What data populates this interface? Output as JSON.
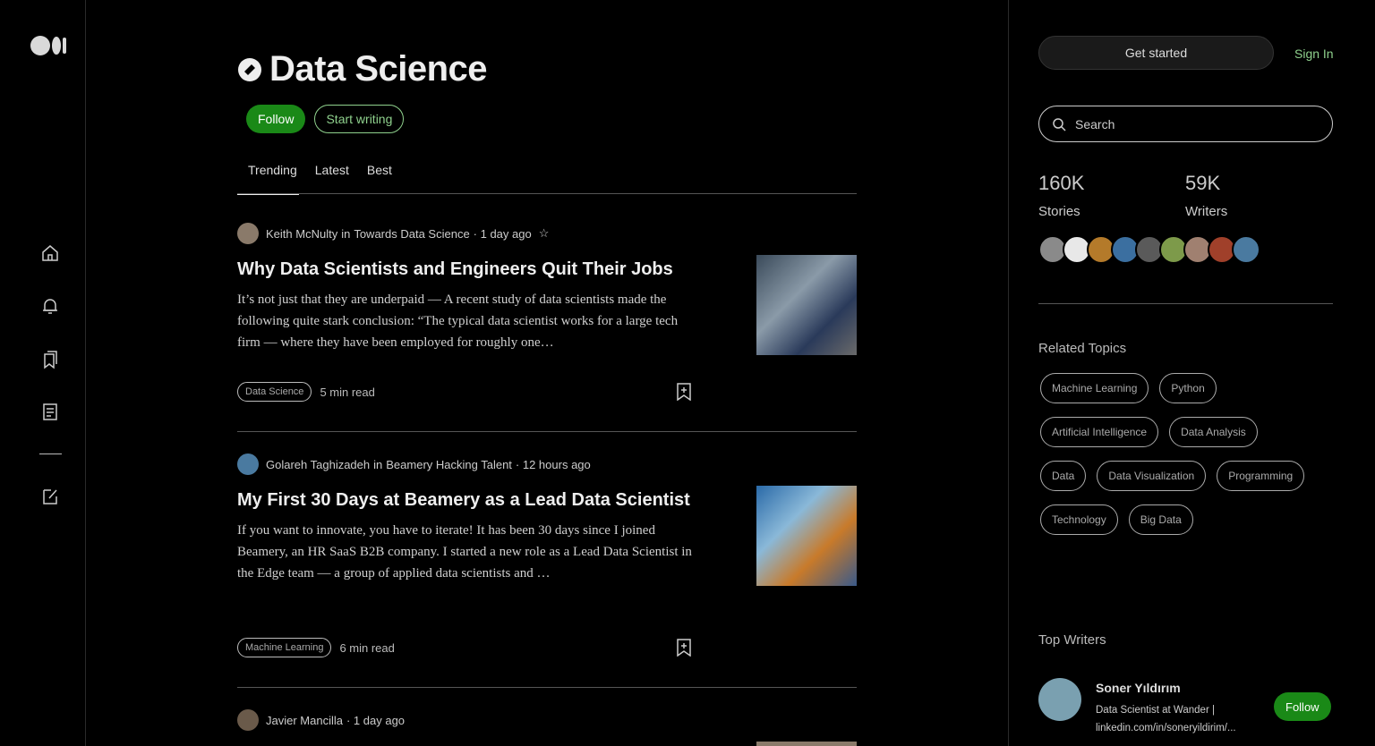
{
  "nav": {
    "icons": [
      "medium-logo",
      "home-icon",
      "bell-icon",
      "bookmarks-icon",
      "stories-icon",
      "write-icon"
    ]
  },
  "topic": {
    "title": "Data Science",
    "follow_label": "Follow",
    "write_label": "Start writing",
    "tabs": [
      "Trending",
      "Latest",
      "Best"
    ],
    "active_tab": "Trending"
  },
  "articles": [
    {
      "author": "Keith McNulty",
      "in_word": "in",
      "publication": "Towards Data Science",
      "time": "· 1 day ago",
      "star": "☆",
      "title": "Why Data Scientists and Engineers Quit Their Jobs",
      "excerpt": "It’s not just that they are underpaid — A recent study of data scientists made the following quite stark conclusion: “The typical data scientist works for a large tech firm — where they have been employed for roughly one…",
      "tag": "Data Science",
      "read_time": "5 min read"
    },
    {
      "author": "Golareh Taghizadeh",
      "in_word": "in",
      "publication": "Beamery Hacking Talent",
      "time": "· 12 hours ago",
      "star": "",
      "title": "My First 30 Days at Beamery as a Lead Data Scientist",
      "excerpt": "If you want to innovate, you have to iterate! It has been 30 days since I joined Beamery, an HR SaaS B2B company. I started a new role as a Lead Data Scientist in the Edge team — a group of applied data scientists and …",
      "tag": "Machine Learning",
      "read_time": "6 min read"
    },
    {
      "author": "Javier Mancilla",
      "in_word": "",
      "publication": "",
      "time": "· 1 day ago",
      "star": ""
    }
  ],
  "sidebar": {
    "get_started": "Get started",
    "sign_in": "Sign In",
    "search_placeholder": "Search",
    "stats": [
      {
        "value": "160K",
        "label": "Stories"
      },
      {
        "value": "59K",
        "label": "Writers"
      }
    ],
    "related_title": "Related Topics",
    "related_topics": [
      "Machine Learning",
      "Python",
      "Artificial Intelligence",
      "Data Analysis",
      "Data",
      "Data Visualization",
      "Programming",
      "Technology",
      "Big Data"
    ],
    "top_writers_title": "Top Writers",
    "writer": {
      "name": "Soner Yıldırım",
      "bio": "Data Scientist at Wander | linkedin.com/in/soneryildirim/...",
      "follow_label": "Follow"
    },
    "face_colors": [
      "#8a8a8a",
      "#e8e8e8",
      "#b47a2a",
      "#3b6fa0",
      "#5a5a5a",
      "#7d9a4a",
      "#a08070",
      "#a0402a",
      "#4a7aa0"
    ]
  }
}
